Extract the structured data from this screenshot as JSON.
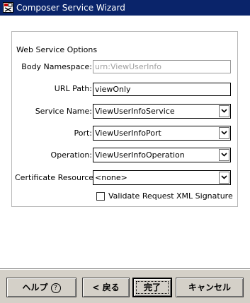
{
  "window": {
    "title": "Composer Service Wizard"
  },
  "group": {
    "legend": "Web Service Options"
  },
  "fields": {
    "body_namespace": {
      "label": "Body Namespace:",
      "value": "urn:ViewUserInfo"
    },
    "url_path": {
      "label": "URL Path:",
      "value": "viewOnly"
    },
    "service_name": {
      "label": "Service Name:",
      "value": "ViewUserInfoService"
    },
    "port": {
      "label": "Port:",
      "value": "ViewUserInfoPort"
    },
    "operation": {
      "label": "Operation:",
      "value": "ViewUserInfoOperation"
    },
    "certificate_resource": {
      "label": "Certificate Resource:",
      "value": "<none>"
    }
  },
  "validate_signature": {
    "label": "Validate Request XML Signature",
    "checked": false
  },
  "buttons": {
    "help": "ヘルプ",
    "help_icon": "?",
    "back": "< 戻る",
    "finish": "完了",
    "cancel": "キャンセル"
  }
}
